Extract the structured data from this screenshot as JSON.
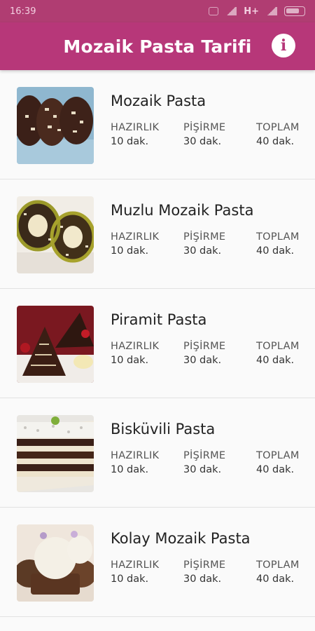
{
  "status_bar": {
    "time": "16:39",
    "network": "H+",
    "battery": "90"
  },
  "app_bar": {
    "title": "Mozaik Pasta Tarifi",
    "info_icon": "info-icon"
  },
  "colors": {
    "primary": "#b73779",
    "status_bar": "#b03d72"
  },
  "recipes": [
    {
      "title": "Mozaik Pasta",
      "prep_label": "HAZIRLIK",
      "prep": "10 dak.",
      "cook_label": "PİŞİRME",
      "cook": "30 dak.",
      "total_label": "TOPLAM",
      "total": "40 dak."
    },
    {
      "title": "Muzlu Mozaik Pasta",
      "prep_label": "HAZIRLIK",
      "prep": "10 dak.",
      "cook_label": "PİŞİRME",
      "cook": "30 dak.",
      "total_label": "TOPLAM",
      "total": "40 dak."
    },
    {
      "title": "Piramit Pasta",
      "prep_label": "HAZIRLIK",
      "prep": "10 dak.",
      "cook_label": "PİŞİRME",
      "cook": "30 dak.",
      "total_label": "TOPLAM",
      "total": "40 dak."
    },
    {
      "title": "Bisküvili Pasta",
      "prep_label": "HAZIRLIK",
      "prep": "10 dak.",
      "cook_label": "PİŞİRME",
      "cook": "30 dak.",
      "total_label": "TOPLAM",
      "total": "40 dak."
    },
    {
      "title": "Kolay Mozaik Pasta",
      "prep_label": "HAZIRLIK",
      "prep": "10 dak.",
      "cook_label": "PİŞİRME",
      "cook": "30 dak.",
      "total_label": "TOPLAM",
      "total": "40 dak."
    }
  ]
}
